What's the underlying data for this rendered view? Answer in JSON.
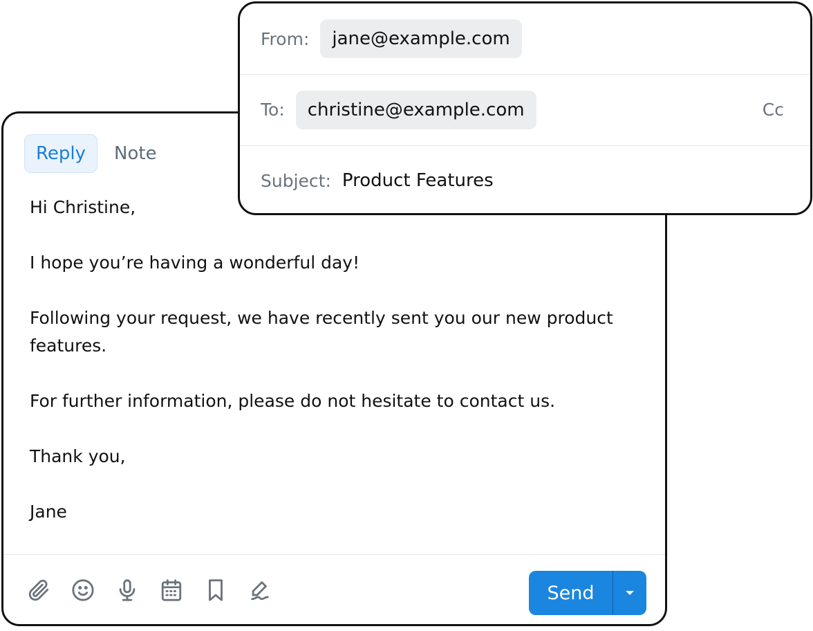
{
  "composer": {
    "tabs": [
      {
        "label": "Reply",
        "active": true
      },
      {
        "label": "Note",
        "active": false
      }
    ],
    "body_paragraphs": [
      "Hi Christine,",
      "I hope you’re having a wonderful day!",
      "Following your request, we have recently sent you our new product features.",
      "For further information, please do not hesitate to contact us.",
      "Thank you,",
      "Jane"
    ],
    "toolbar_icons": [
      "paperclip-icon",
      "emoji-icon",
      "microphone-icon",
      "calendar-icon",
      "bookmark-icon",
      "signature-pen-icon"
    ],
    "send_label": "Send",
    "accent_color": "#1a86e0"
  },
  "header": {
    "from_label": "From:",
    "from_value": "jane@example.com",
    "to_label": "To:",
    "to_value": "christine@example.com",
    "cc_label": "Cc",
    "subject_label": "Subject:",
    "subject_value": "Product Features"
  }
}
